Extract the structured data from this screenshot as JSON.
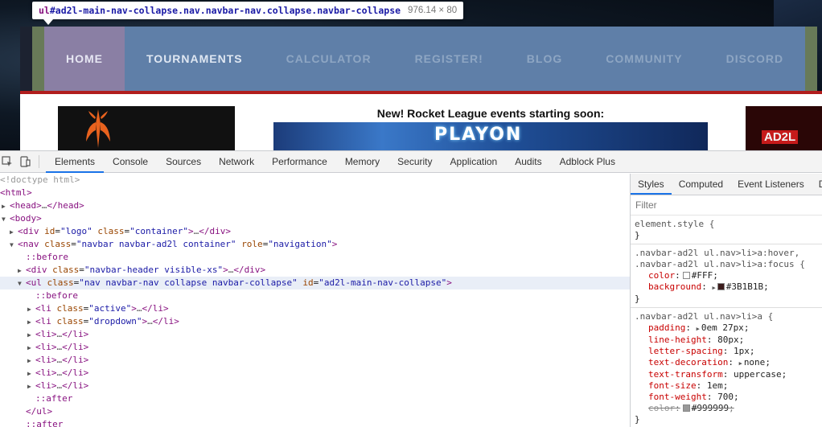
{
  "tooltip": {
    "selector_prefix": "ul",
    "selector_rest": "#ad2l-main-nav-collapse.nav.navbar-nav.collapse.navbar-collapse",
    "dimensions": "976.14 × 80"
  },
  "site": {
    "nav": [
      "HOME",
      "TOURNAMENTS",
      "CALCULATOR",
      "REGISTER!",
      "BLOG",
      "COMMUNITY",
      "DISCORD"
    ],
    "promo_title": "New! Rocket League events starting soon:",
    "promo_banner_text": "PLAYON",
    "right_ad_text": "AD2L"
  },
  "devtools": {
    "tabs": [
      "Elements",
      "Console",
      "Sources",
      "Network",
      "Performance",
      "Memory",
      "Security",
      "Application",
      "Audits",
      "Adblock Plus"
    ],
    "active_tab": "Elements",
    "styles_tabs": [
      "Styles",
      "Computed",
      "Event Listeners",
      "D"
    ],
    "filter_placeholder": "Filter",
    "dom_lines": [
      {
        "indent": 0,
        "tri": "",
        "html": "doctype"
      },
      {
        "indent": 0,
        "tri": "",
        "html": "html-open"
      },
      {
        "indent": 0,
        "tri": "▶",
        "html": "head"
      },
      {
        "indent": 0,
        "tri": "▼",
        "html": "body-open"
      },
      {
        "indent": 1,
        "tri": "▶",
        "html": "div-logo"
      },
      {
        "indent": 1,
        "tri": "▼",
        "html": "nav-open"
      },
      {
        "indent": 2,
        "tri": "",
        "html": "before1"
      },
      {
        "indent": 2,
        "tri": "▶",
        "html": "div-header"
      },
      {
        "indent": 2,
        "tri": "▼",
        "html": "ul-open",
        "selected": true
      },
      {
        "indent": 3,
        "tri": "",
        "html": "before2"
      },
      {
        "indent": 3,
        "tri": "▶",
        "html": "li-active"
      },
      {
        "indent": 3,
        "tri": "▶",
        "html": "li-dropdown"
      },
      {
        "indent": 3,
        "tri": "▶",
        "html": "li"
      },
      {
        "indent": 3,
        "tri": "▶",
        "html": "li"
      },
      {
        "indent": 3,
        "tri": "▶",
        "html": "li"
      },
      {
        "indent": 3,
        "tri": "▶",
        "html": "li"
      },
      {
        "indent": 3,
        "tri": "▶",
        "html": "li"
      },
      {
        "indent": 3,
        "tri": "",
        "html": "after1"
      },
      {
        "indent": 2,
        "tri": "",
        "html": "ul-close"
      },
      {
        "indent": 2,
        "tri": "",
        "html": "after2"
      }
    ],
    "dom_text": {
      "doctype": "<!doctype html>",
      "html_tag": "html",
      "head_tag": "head",
      "body_tag": "body",
      "div_tag": "div",
      "nav_tag": "nav",
      "ul_tag": "ul",
      "li_tag": "li",
      "attr_id": "id",
      "attr_class": "class",
      "attr_role": "role",
      "logo_id": "\"logo\"",
      "container_class": "\"container\"",
      "nav_class": "\"navbar navbar-ad2l container\"",
      "nav_role": "\"navigation\"",
      "header_class": "\"navbar-header visible-xs\"",
      "ul_class": "\"nav navbar-nav collapse navbar-collapse\"",
      "ul_id": "\"ad2l-main-nav-collapse\"",
      "active_class": "\"active\"",
      "dropdown_class": "\"dropdown\"",
      "before": "::before",
      "after": "::after",
      "ellipsis": "…"
    },
    "styles": {
      "element_style": "element.style {",
      "close_brace": "}",
      "rule1_selector_a": ".navbar-ad2l ul.nav>li>a:hover,",
      "rule1_selector_b": ".navbar-ad2l ul.nav>li>a:focus {",
      "rule1_decls": [
        {
          "prop": "color",
          "val": "#FFF",
          "swatch": "#FFFFFF"
        },
        {
          "prop": "background",
          "val": "#3B1B1B",
          "swatch": "#3B1B1B",
          "tri": true
        }
      ],
      "rule2_selector": ".navbar-ad2l ul.nav>li>a {",
      "rule2_decls": [
        {
          "prop": "padding",
          "val": "0em 27px",
          "tri": true
        },
        {
          "prop": "line-height",
          "val": "80px"
        },
        {
          "prop": "letter-spacing",
          "val": "1px"
        },
        {
          "prop": "text-decoration",
          "val": "none",
          "tri": true
        },
        {
          "prop": "text-transform",
          "val": "uppercase"
        },
        {
          "prop": "font-size",
          "val": "1em"
        },
        {
          "prop": "font-weight",
          "val": "700"
        },
        {
          "prop": "color",
          "val": "#999999",
          "swatch": "#999999",
          "strike": true
        }
      ]
    }
  }
}
